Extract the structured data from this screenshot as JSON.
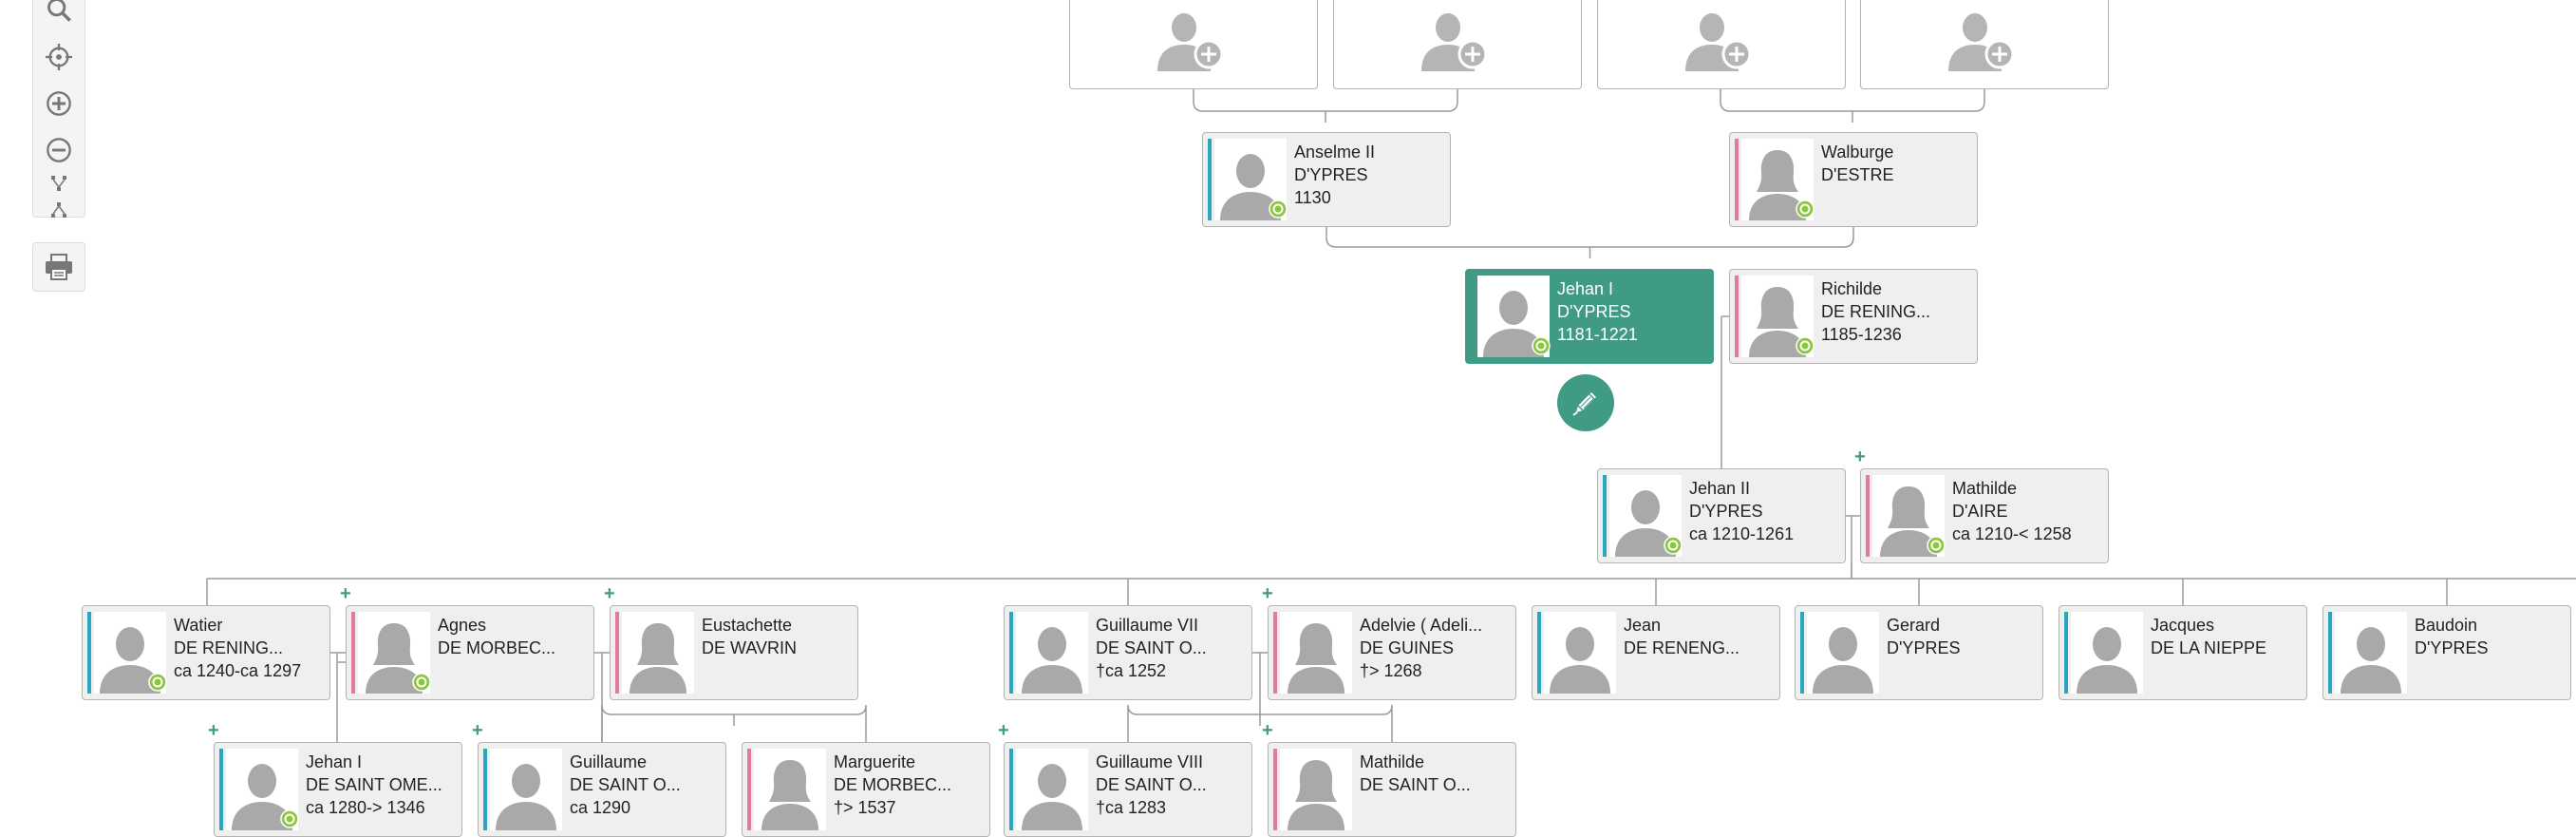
{
  "colors": {
    "accent": "#3f9a86",
    "male": "#2aa6bf",
    "female": "#e07aa0",
    "badge": "#8cc63f"
  },
  "toolbar": {
    "tools": [
      {
        "name": "search-icon"
      },
      {
        "name": "crosshair-icon"
      },
      {
        "name": "zoom-in-icon"
      },
      {
        "name": "zoom-out-icon"
      },
      {
        "name": "tree-down-icon"
      },
      {
        "name": "tree-up-icon"
      }
    ],
    "print": {
      "name": "print-icon"
    }
  },
  "add_parent_placeholders": 4,
  "people": [
    {
      "id": "anselme",
      "line1": "Anselme II",
      "line2": "D'YPRES",
      "line3": "1130",
      "sex": "male",
      "badge": true,
      "plus": false
    },
    {
      "id": "walburge",
      "line1": "Walburge",
      "line2": "D'ESTRE",
      "line3": "",
      "sex": "female",
      "badge": true,
      "plus": false
    },
    {
      "id": "jehan1",
      "line1": "Jehan I",
      "line2": "D'YPRES",
      "line3": "1181-1221",
      "sex": "male",
      "badge": true,
      "plus": false,
      "focus": true
    },
    {
      "id": "richilde",
      "line1": "Richilde",
      "line2": "DE RENING...",
      "line3": "1185-1236",
      "sex": "female",
      "badge": true,
      "plus": false
    },
    {
      "id": "jehan2",
      "line1": "Jehan II",
      "line2": "D'YPRES",
      "line3": "ca 1210-1261",
      "sex": "male",
      "badge": true,
      "plus": false
    },
    {
      "id": "mathilde_aire",
      "line1": "Mathilde",
      "line2": "D'AIRE",
      "line3": "ca 1210-< 1258",
      "sex": "female",
      "badge": true,
      "plus": true
    },
    {
      "id": "watier",
      "line1": "Watier",
      "line2": "DE RENING...",
      "line3": "ca 1240-ca 1297",
      "sex": "male",
      "badge": true,
      "plus": false
    },
    {
      "id": "agnes",
      "line1": "Agnes",
      "line2": "DE MORBEC...",
      "line3": "",
      "sex": "female",
      "badge": true,
      "plus": true
    },
    {
      "id": "eustachette",
      "line1": "Eustachette",
      "line2": "DE WAVRIN",
      "line3": "",
      "sex": "female",
      "badge": false,
      "plus": true
    },
    {
      "id": "guillaume7",
      "line1": "Guillaume VII",
      "line2": "DE SAINT O...",
      "line3": "†ca 1252",
      "sex": "male",
      "badge": false,
      "plus": false
    },
    {
      "id": "adelvie",
      "line1": "Adelvie ( Adeli...",
      "line2": "DE GUINES",
      "line3": "†> 1268",
      "sex": "female",
      "badge": false,
      "plus": true
    },
    {
      "id": "jean",
      "line1": "Jean",
      "line2": "DE RENENG...",
      "line3": "",
      "sex": "male",
      "badge": false,
      "plus": false
    },
    {
      "id": "gerard",
      "line1": "Gerard",
      "line2": "D'YPRES",
      "line3": "",
      "sex": "male",
      "badge": false,
      "plus": false
    },
    {
      "id": "jacques",
      "line1": "Jacques",
      "line2": "DE LA NIEPPE",
      "line3": "",
      "sex": "male",
      "badge": false,
      "plus": false
    },
    {
      "id": "baudoin",
      "line1": "Baudoin",
      "line2": "D'YPRES",
      "line3": "",
      "sex": "male",
      "badge": false,
      "plus": false
    },
    {
      "id": "jehan_so",
      "line1": "Jehan I",
      "line2": "DE SAINT OME...",
      "line3": "ca 1280-> 1346",
      "sex": "male",
      "badge": true,
      "plus": true
    },
    {
      "id": "guillaume_so",
      "line1": "Guillaume",
      "line2": "DE SAINT O...",
      "line3": "ca 1290",
      "sex": "male",
      "badge": false,
      "plus": true
    },
    {
      "id": "marguerite",
      "line1": "Marguerite",
      "line2": "DE MORBEC...",
      "line3": "†> 1537",
      "sex": "female",
      "badge": false,
      "plus": false
    },
    {
      "id": "guillaume8",
      "line1": "Guillaume VIII",
      "line2": "DE SAINT O...",
      "line3": "†ca 1283",
      "sex": "male",
      "badge": false,
      "plus": true
    },
    {
      "id": "mathilde_so",
      "line1": "Mathilde",
      "line2": "DE SAINT O...",
      "line3": "",
      "sex": "female",
      "badge": false,
      "plus": true
    }
  ]
}
